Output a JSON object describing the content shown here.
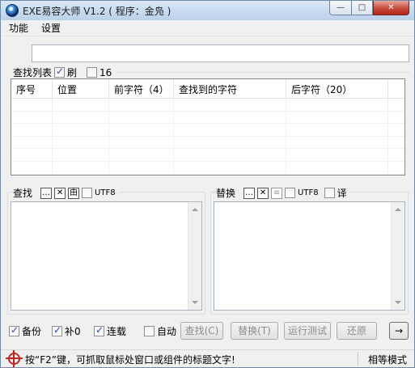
{
  "window": {
    "title": "EXE易容大师 V1.2 ( 程序：金凫 )",
    "caption": {
      "minimize": "—",
      "maximize": "□",
      "close": "✕"
    }
  },
  "menu": {
    "items": [
      "功能",
      "设置"
    ]
  },
  "top_input": {
    "value": ""
  },
  "search_list": {
    "label": "查找列表",
    "refresh_label": "刷",
    "refresh_checked": true,
    "hex_label": "16",
    "hex_checked": false,
    "columns": [
      "序号",
      "位置",
      "前字符（4）",
      "查找到的字符",
      "后字符（20）"
    ]
  },
  "find_panel": {
    "label": "查找",
    "more_btn": "…",
    "clear_btn": "✕",
    "char_btn": "由",
    "utf8_label": "UTF8",
    "utf8_checked": false,
    "text": ""
  },
  "replace_panel": {
    "label": "替换",
    "more_btn": "…",
    "clear_btn": "✕",
    "eq_btn": "≡",
    "utf8_label": "UTF8",
    "utf8_checked": false,
    "translate_label": "译",
    "translate_checked": false,
    "text": ""
  },
  "options": {
    "backup_label": "备份",
    "backup_checked": true,
    "pad_label": "补0",
    "pad_checked": true,
    "chain_label": "连载",
    "chain_checked": true,
    "auto_label": "自动",
    "auto_checked": false
  },
  "buttons": {
    "find": "查找(C)",
    "replace": "替换(T)",
    "run_test": "运行测试",
    "restore": "还原",
    "arrow": "→"
  },
  "status": {
    "hint": "按“F2”键，可抓取鼠标处窗口或组件的标题文字!",
    "mode": "相等模式"
  }
}
